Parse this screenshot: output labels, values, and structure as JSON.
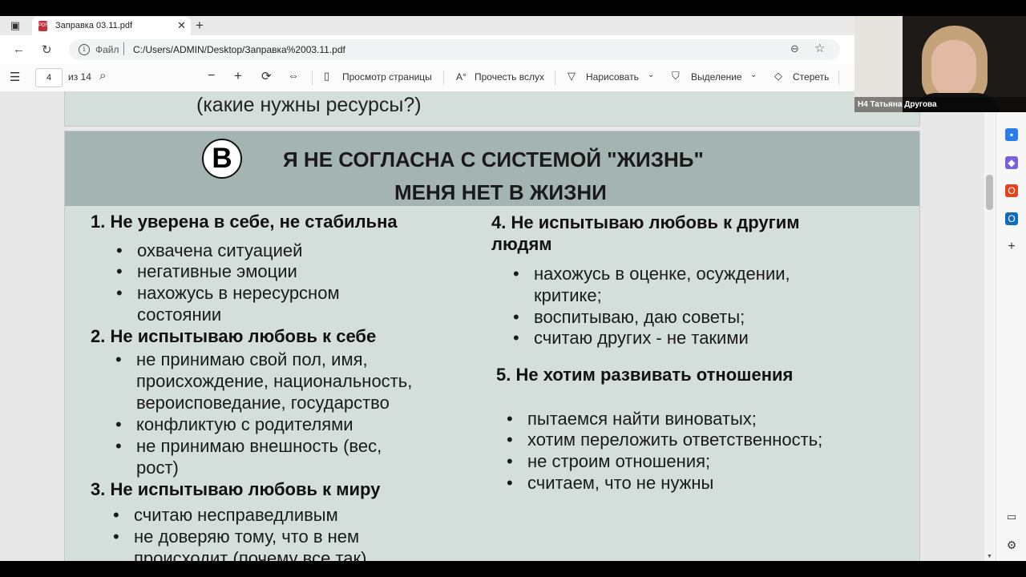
{
  "browser": {
    "tab_title": "Заправка 03.11.pdf",
    "address_scheme_label": "Файл",
    "url": "C:/Users/ADMIN/Desktop/Заправка%2003.11.pdf"
  },
  "pdf_toolbar": {
    "page_number": "4",
    "page_total": "из 14",
    "page_view": "Просмотр страницы",
    "read_aloud": "Прочесть вслух",
    "draw": "Нарисовать",
    "highlight": "Выделение",
    "erase": "Стереть"
  },
  "previous_page": {
    "text": "(какие нужны ресурсы?)"
  },
  "slide": {
    "badge": "В",
    "title_line1": "Я НЕ СОГЛАСНА С СИСТЕМОЙ \"ЖИЗНЬ\"",
    "title_line2": "МЕНЯ НЕТ В ЖИЗНИ",
    "sections": [
      {
        "heading": "1. Не уверена в себе, не стабильна",
        "items": [
          "охвачена ситуацией",
          "негативные эмоции",
          "нахожусь в нересурсном\nсостоянии"
        ]
      },
      {
        "heading": "2. Не испытываю любовь к себе",
        "items": [
          "не принимаю свой пол, имя,\nпроисхождение, национальность,\nвероисповедание, государство",
          "конфликтую с родителями",
          "не принимаю внешность (вес,\nрост)"
        ]
      },
      {
        "heading": "3. Не испытываю любовь к миру",
        "items": [
          "считаю несправедливым",
          "не доверяю тому, что в нем\nпроисходит (почему все так)"
        ]
      },
      {
        "heading": "4. Не испытываю любовь к другим\nлюдям",
        "items": [
          "нахожусь в оценке, осуждении,\nкритике;",
          "воспитываю, даю советы;",
          "считаю других - не такими"
        ]
      },
      {
        "heading": "5. Не хотим развивать отношения",
        "items": [
          "пытаемся найти виноватых;",
          "хотим переложить ответственность;",
          "не строим отношения;",
          "считаем, что не нужны"
        ]
      }
    ]
  },
  "video": {
    "participant_name": "Н4 Татьяна Другова"
  }
}
